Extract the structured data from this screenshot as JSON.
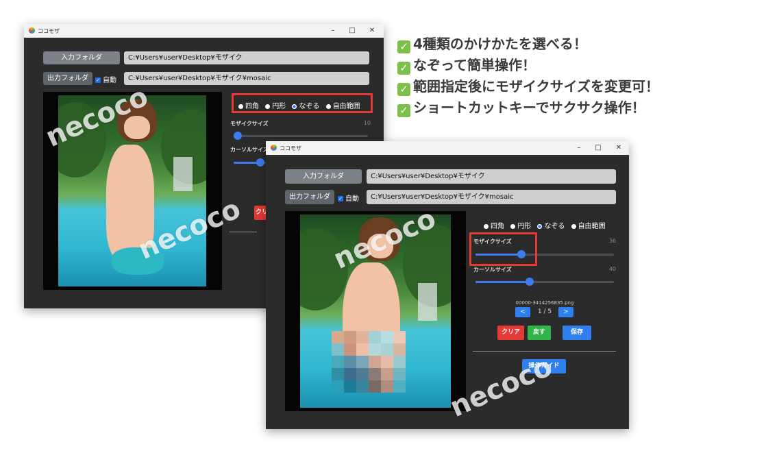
{
  "window_back": {
    "title": "ココモザ",
    "controls": {
      "minimize": "–",
      "maximize": "□",
      "close": "✕"
    },
    "input_folder_label": "入力フォルダ",
    "input_folder_path": "C:¥Users¥user¥Desktop¥モザイク",
    "output_folder_label": "出力フォルダ",
    "auto_label": "自動",
    "auto_checked": true,
    "output_folder_path": "C:¥Users¥user¥Desktop¥モザイク¥mosaic",
    "modes": [
      "四角",
      "円形",
      "なぞる",
      "自由範囲"
    ],
    "selected_mode": "なぞる",
    "mosaic_size_label": "モザイクサイズ",
    "mosaic_size_value": "10",
    "cursor_size_label": "カーソルサイズ",
    "clear_label_partial": "クリ"
  },
  "window_front": {
    "title": "ココモザ",
    "controls": {
      "minimize": "–",
      "maximize": "□",
      "close": "✕"
    },
    "input_folder_label": "入力フォルダ",
    "input_folder_path": "C:¥Users¥user¥Desktop¥モザイク",
    "output_folder_label": "出力フォルダ",
    "auto_label": "自動",
    "auto_checked": true,
    "output_folder_path": "C:¥Users¥user¥Desktop¥モザイク¥mosaic",
    "modes": [
      "四角",
      "円形",
      "なぞる",
      "自由範囲"
    ],
    "selected_mode": "なぞる",
    "mosaic_size_label": "モザイクサイズ",
    "mosaic_size_value": "36",
    "cursor_size_label": "カーソルサイズ",
    "cursor_size_value": "40",
    "filename": "00000-3414256835.png",
    "prev_label": "<",
    "next_label": ">",
    "page_info": "1 / 5",
    "clear_label": "クリア",
    "undo_label": "戻す",
    "save_label": "保存",
    "guide_label": "操作ガイド"
  },
  "features": [
    "4種類のかけかたを選べる！",
    "なぞって簡単操作！",
    "範囲指定後にモザイクサイズを変更可！",
    "ショートカットキーでサクサク操作！"
  ],
  "feature_check_icon": "check-icon",
  "watermark_text": "necoco",
  "colors": {
    "accent_blue": "#3d7bf0",
    "highlight_red": "#e53935",
    "clear_red": "#e53935",
    "undo_green": "#2fb44a",
    "check_green": "#7cc04a"
  }
}
